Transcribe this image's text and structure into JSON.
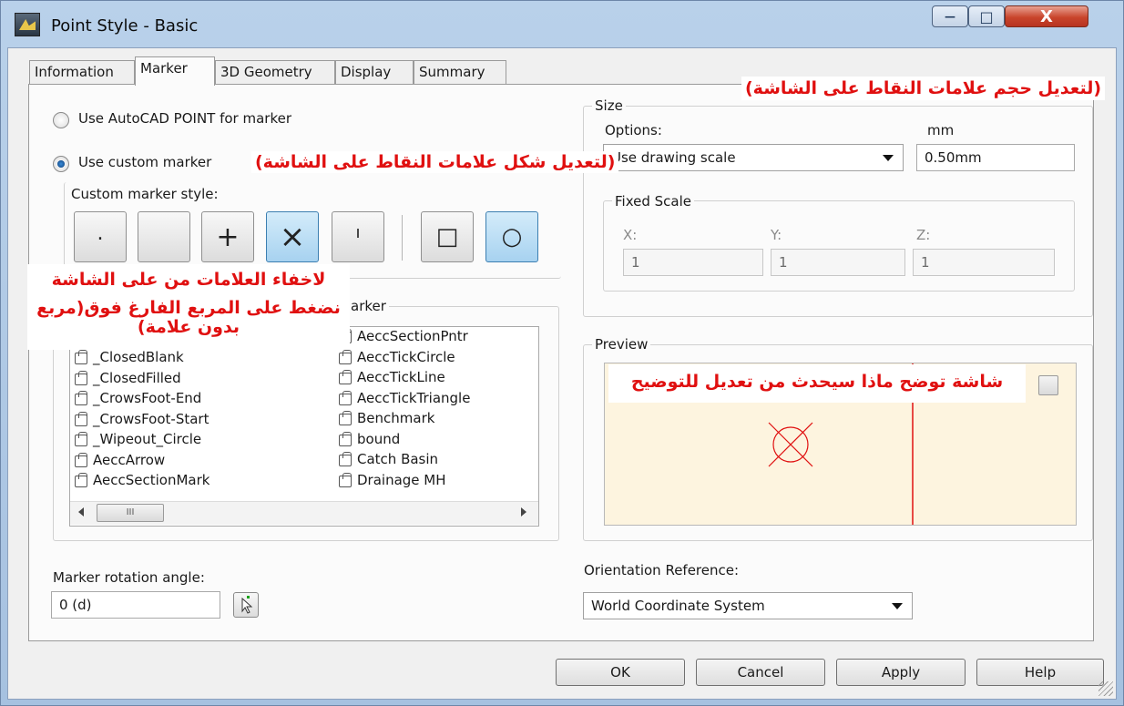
{
  "window": {
    "title": "Point Style - Basic",
    "min_glyph": "—",
    "max_glyph": "□",
    "close_glyph": "X"
  },
  "tabs": [
    "Information",
    "Marker",
    "3D Geometry",
    "Display",
    "Summary"
  ],
  "active_tab": "Marker",
  "marker": {
    "use_autocad_label": "Use AutoCAD POINT for marker",
    "use_custom_label": "Use custom marker",
    "custom_style_label": "Custom marker style:",
    "custom_buttons": [
      ".",
      "",
      "+",
      "×",
      "ı",
      "□",
      "○"
    ],
    "block_group_label": "arker",
    "blocks_col1": [
      "_ClosedBlank",
      "_ClosedFilled",
      "_CrowsFoot-End",
      "_CrowsFoot-Start",
      "_Wipeout_Circle",
      "AeccArrow",
      "AeccSectionMark"
    ],
    "blocks_col2": [
      "AeccSectionPntr",
      "AeccTickCircle",
      "AeccTickLine",
      "AeccTickTriangle",
      "Benchmark",
      "bound",
      "Catch Basin",
      "Drainage MH"
    ],
    "rotation_label": "Marker rotation angle:",
    "rotation_value": "0 (d)",
    "scroll_thumb": "III"
  },
  "size": {
    "group_label": "Size",
    "options_label": "Options:",
    "options_value": "Use drawing scale",
    "units_label": "mm",
    "units_value": "0.50mm",
    "fixed_scale_label": "Fixed Scale",
    "x_label": "X:",
    "x_value": "1",
    "y_label": "Y:",
    "y_value": "1",
    "z_label": "Z:",
    "z_value": "1"
  },
  "preview": {
    "group_label": "Preview"
  },
  "orientation": {
    "label": "Orientation Reference:",
    "value": "World Coordinate System"
  },
  "buttons": {
    "ok": "OK",
    "cancel": "Cancel",
    "apply": "Apply",
    "help": "Help"
  },
  "annotations": {
    "size": "(لتعديل حجم علامات النقاط على الشاشة)",
    "shape": "(لتعديل شكل علامات النقاط على الشاشة)",
    "hide_line1": "لاخفاء العلامات من على الشاشة",
    "hide_line2": "نضغط على المربع الفارغ فوق(مربع",
    "hide_line3": "بدون علامة)",
    "preview": "شاشة توضح ماذا سيحدث من تعديل للتوضيح"
  },
  "colors": {
    "annotation": "#e01010",
    "preview_bg": "#fdf4df",
    "preview_mark": "#e01010",
    "selected_button": "#a7d2f0"
  }
}
